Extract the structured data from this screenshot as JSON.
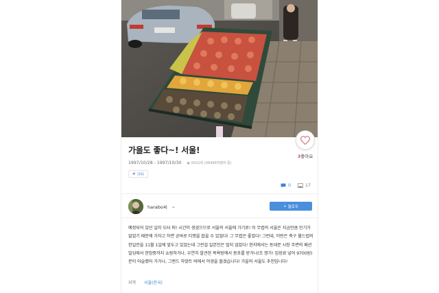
{
  "post": {
    "title": "가을도 좋다~! 서울!",
    "dates": "1997/10/28 - 1997/10/30",
    "views": "0022회 (06496여행자 중)",
    "tag": "기타",
    "like_count": "3",
    "like_label": "좋아요",
    "comment_count": "0",
    "photo_count": "17"
  },
  "author": {
    "name": "harabo씨",
    "follow_label": "팔로우"
  },
  "body": "예정되어 있던 일이 도터 퍼! 시간이 생겼으므로 서울의 서울에 가기로! 이 무렵의 서울은 지금만큼 인기가 없었기 때문에 가자고 하면 곧바로 티켓을 잡을 수 있었다! 그 무렵은 좋았다! 그런데, 이번은 축구 월드컵의 한일전을 11월 1일에 앞두고 있었는데 그런걸 일본인은 많지 않았다! 현지에서는 동대문 시장 주변의 패션 빌딩에서 한밤중까지 쇼핑하거나, 우연히 발견한 목욕탕에서 몽초를 받거나(조 명가! 입장료 넣어 9700원) 분이 아슬했어 가거나, 그랜드 하얏트 바에서 야경을 즐겼습니다! 가을의 서울도 추천입니다!",
  "meta": {
    "region_label": "지역",
    "region_value": "서울(한국)"
  },
  "icons": {
    "like": "heart-icon",
    "views": "eye-icon",
    "tag": "hash-icon",
    "comment": "comment-icon",
    "photo": "photo-icon",
    "chevron": "chevron-down-icon",
    "follow": "plus-icon"
  },
  "colors": {
    "accent": "#4a8fdc",
    "like": "#e0475b",
    "link": "#3a86d6"
  }
}
